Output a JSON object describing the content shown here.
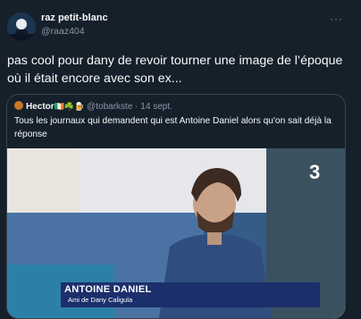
{
  "tweet": {
    "author_name": "raz petit-blanc",
    "author_handle": "@raaz404",
    "more_icon": "more-horizontal-icon",
    "text": "pas cool pour dany de revoir tourner une image de l’époque où il était encore avec son ex..."
  },
  "quoted": {
    "author_name": "Hector",
    "author_emoji": "🇮🇪☘️🍺",
    "author_handle": "@tobarkste",
    "separator": "·",
    "date": "14 sept.",
    "text": "Tous les journaux qui demandent qui est Antoine Daniel alors qu'on sait déjà la réponse",
    "media": {
      "lower_third_name": "ANTOINE DANIEL",
      "lower_third_subtitle": "Ami de Dany Caligula",
      "channel_logo": "3"
    }
  }
}
